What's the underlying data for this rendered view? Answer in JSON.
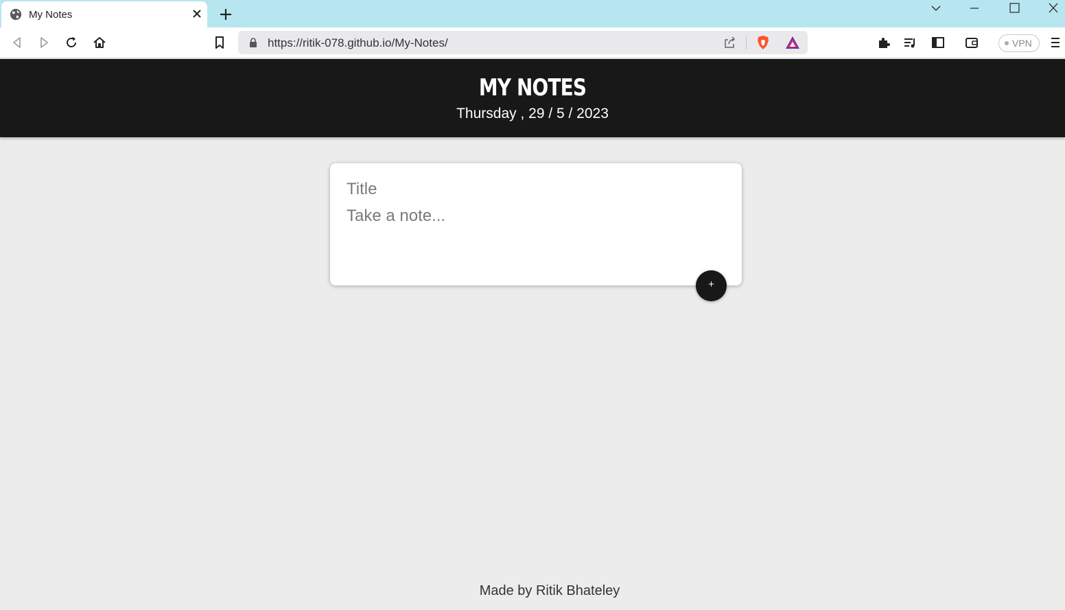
{
  "browser": {
    "tab": {
      "title": "My Notes",
      "icon": "globe-icon"
    },
    "address_bar": {
      "url": "https://ritik-078.github.io/My-Notes/"
    },
    "vpn_label": "VPN"
  },
  "page": {
    "header": {
      "title": "MY NOTES",
      "date": "Thursday , 29 / 5 / 2023"
    },
    "note_form": {
      "title_placeholder": "Title",
      "body_placeholder": "Take a note...",
      "add_label": "+"
    },
    "footer": "Made by Ritik Bhateley"
  },
  "colors": {
    "tabstrip": "#b7e6f1",
    "header_bg": "#181818",
    "page_bg": "#ececec",
    "card_bg": "#ffffff"
  }
}
